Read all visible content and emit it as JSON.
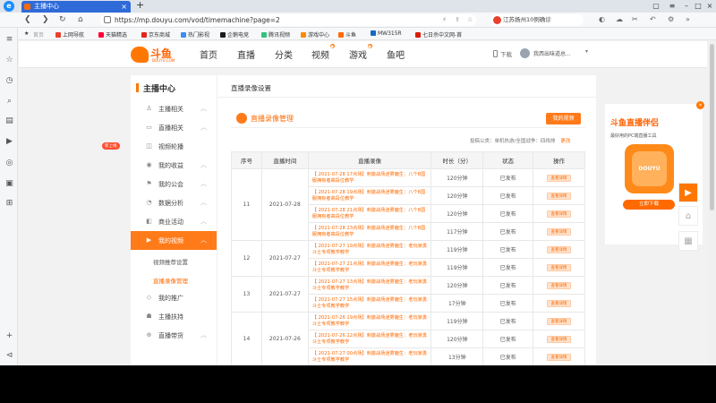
{
  "browser": {
    "tab_title": "主播中心",
    "url": "https://mp.douyu.com/vod/timemachine?page=2",
    "search_text": "江苏扬州10例确诊",
    "bookmarks": [
      "首页",
      "上网导航",
      "天猫精选",
      "京东商城",
      "热门影视",
      "企鹅电竞",
      "腾讯视频",
      "游戏中心",
      "斗鱼",
      "MW315R",
      "七日杀中文网-首"
    ]
  },
  "site": {
    "logo_text": "斗鱼",
    "logo_sub": "DOUYU.COM",
    "nav": [
      "首页",
      "直播",
      "分类",
      "视频",
      "游戏",
      "鱼吧"
    ],
    "download": "下载",
    "user_name": "我西出味道总..."
  },
  "menu": {
    "title": "主播中心",
    "items": [
      {
        "label": "主播相关",
        "icon": "user-icon"
      },
      {
        "label": "直播相关",
        "icon": "broadcast-icon"
      },
      {
        "label": "视频轮播",
        "icon": "carousel-icon"
      },
      {
        "label": "我的收益",
        "icon": "coin-icon"
      },
      {
        "label": "我的公会",
        "icon": "guild-icon"
      },
      {
        "label": "数据分析",
        "icon": "chart-icon"
      },
      {
        "label": "商业活动",
        "icon": "bag-icon"
      },
      {
        "label": "我的视频",
        "icon": "video-icon"
      }
    ],
    "sub_items": [
      "视频推荐设置",
      "直播录像管理"
    ],
    "items_after": [
      {
        "label": "我的推广",
        "icon": "promote-icon"
      },
      {
        "label": "主播扶持",
        "icon": "support-icon"
      },
      {
        "label": "直播带货",
        "icon": "cart-icon"
      }
    ],
    "badge": "新上线"
  },
  "main": {
    "title": "直播录像设置",
    "section_title": "直播录像管理",
    "section_button": "我的视频",
    "filter_text": "投稿公类：单机热游/全国战争：四线排",
    "filter_link": "更改",
    "table": {
      "headers": [
        "序号",
        "直播时间",
        "直播录像",
        "时长（分）",
        "状态",
        "操作"
      ],
      "groups": [
        {
          "no": "11",
          "date": "2021-07-28",
          "rows": [
            {
              "title": "【 2021-07-28 17点场】刺激战场迷雾鹿生：八个8国服拥有者高段位教学",
              "dur": "120分钟",
              "status": "已发布",
              "op": "查看详情"
            },
            {
              "title": "【 2021-07-28 19点场】刺激战场迷雾鹿生：八个8国服拥有者高段位教学",
              "dur": "120分钟",
              "status": "已发布",
              "op": "查看详情"
            },
            {
              "title": "【 2021-07-28 21点场】刺激战场迷雾鹿生：八个8国服拥有者高段位教学",
              "dur": "120分钟",
              "status": "已发布",
              "op": "查看详情"
            },
            {
              "title": "【 2021-07-28 23点场】刺激战场迷雾鹿生：八个8国服拥有者高段位教学",
              "dur": "117分钟",
              "status": "已发布",
              "op": "查看详情"
            }
          ]
        },
        {
          "no": "12",
          "date": "2021-07-27",
          "rows": [
            {
              "title": "【 2021-07-27 19点场】刺激战场迷雾鹿生：老玩家勇斗士专项教学教学",
              "dur": "119分钟",
              "status": "已发布",
              "op": "查看详情"
            },
            {
              "title": "【 2021-07-27 21点场】刺激战场迷雾鹿生：老玩家勇斗士专项教学教学",
              "dur": "119分钟",
              "status": "已发布",
              "op": "查看详情"
            }
          ]
        },
        {
          "no": "13",
          "date": "2021-07-27",
          "rows": [
            {
              "title": "【 2021-07-27 13点场】刺激战场迷雾鹿生：老玩家勇斗士专项教学教学",
              "dur": "120分钟",
              "status": "已发布",
              "op": "查看详情"
            },
            {
              "title": "【 2021-07-27 15点场】刺激战场迷雾鹿生：老玩家勇斗士专项教学教学",
              "dur": "17分钟",
              "status": "已发布",
              "op": "查看详情"
            }
          ]
        },
        {
          "no": "14",
          "date": "2021-07-26",
          "rows": [
            {
              "title": "【 2021-07-26 19点场】刺激战场迷雾鹿生：老玩家勇斗士专项教学教学",
              "dur": "119分钟",
              "status": "已发布",
              "op": "查看详情"
            },
            {
              "title": "【 2021-07-26 22点场】刺激战场迷雾鹿生：老玩家勇斗士专项教学教学",
              "dur": "120分钟",
              "status": "已发布",
              "op": "查看详情"
            },
            {
              "title": "【 2021-07-27 00点场】刺激战场迷雾鹿生：老玩家勇斗士专项教学教学",
              "dur": "13分钟",
              "status": "已发布",
              "op": "查看详情"
            }
          ]
        }
      ]
    }
  },
  "ad": {
    "title": "斗鱼直播伴侣",
    "subtitle": "最好用的PC端直播工具",
    "app_label": "DOUYU",
    "button": "立即下载"
  },
  "colors": {
    "accent": "#ff7700",
    "browser_blue": "#2f6bd8"
  }
}
